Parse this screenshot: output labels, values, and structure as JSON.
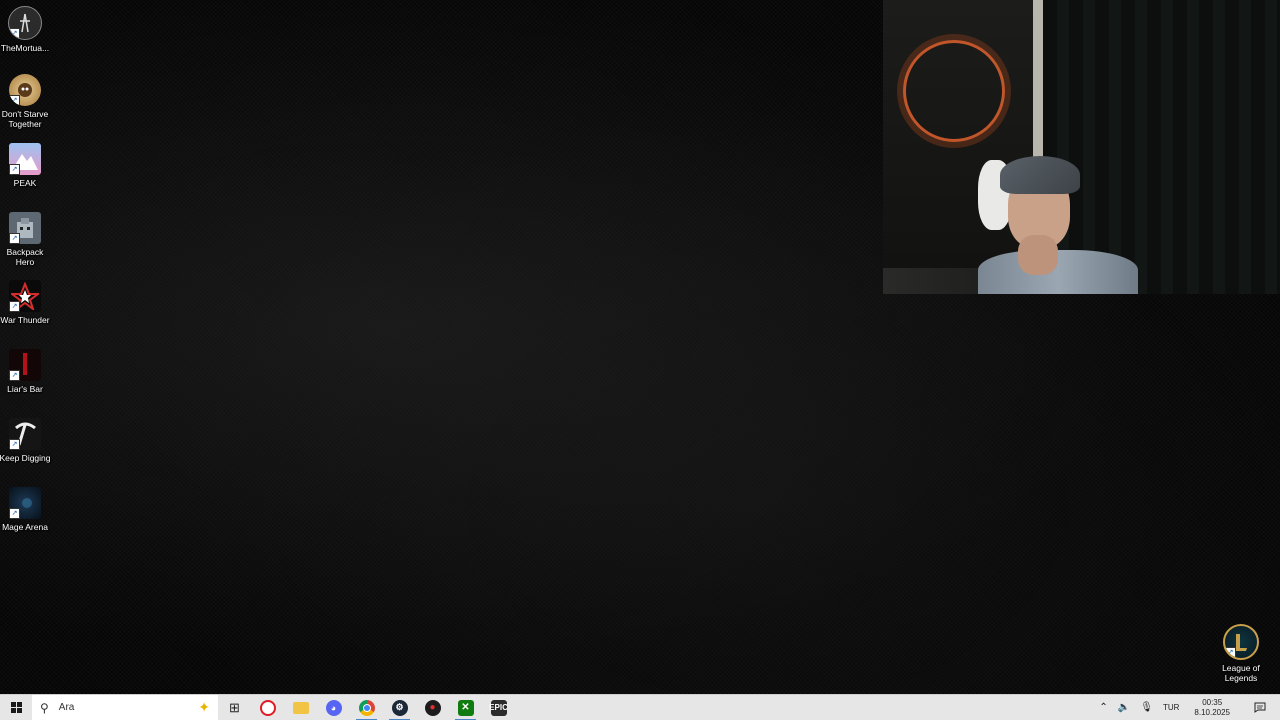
{
  "desktop": {
    "icons": [
      {
        "label": "TheMortua...",
        "icon": "mortuary-assistant-icon",
        "color": "#2b2b2b"
      },
      {
        "label": "Don't Starve\nTogether",
        "icon": "dont-starve-together-icon",
        "color": "#cfa869"
      },
      {
        "label": "PEAK",
        "icon": "peak-icon",
        "color": "#7aa6e0"
      },
      {
        "label": "Backpack\nHero",
        "icon": "backpack-hero-icon",
        "color": "#7f8a94"
      },
      {
        "label": "War Thunder",
        "icon": "war-thunder-icon",
        "color": "#b8252a"
      },
      {
        "label": "Liar's Bar",
        "icon": "liars-bar-icon",
        "color": "#1a0a0a"
      },
      {
        "label": "Keep Digging",
        "icon": "pickaxe-icon",
        "color": "#1e1e1e"
      },
      {
        "label": "Mage Arena",
        "icon": "mage-arena-icon",
        "color": "#0e1b2b"
      },
      {
        "label": "League of\nLegends",
        "icon": "league-of-legends-icon",
        "color": "#c8a04a"
      }
    ]
  },
  "webcam": {
    "content": "streamer-webcam-feed"
  },
  "taskbar": {
    "search_placeholder": "Ara",
    "apps": [
      {
        "name": "task-view",
        "icon": "task-view-icon",
        "glyph": "⊞",
        "color": "#e6e6e6",
        "text": "#222"
      },
      {
        "name": "opera",
        "icon": "opera-icon",
        "glyph": "O",
        "color": "#e01a24",
        "text": "#fff"
      },
      {
        "name": "file-explorer",
        "icon": "folder-icon",
        "glyph": "▬",
        "color": "#f0c040",
        "text": "#c28d00"
      },
      {
        "name": "discord",
        "icon": "discord-icon",
        "glyph": "◉",
        "color": "#5865f2",
        "text": "#fff"
      },
      {
        "name": "chrome",
        "icon": "chrome-icon",
        "glyph": "◎",
        "color": "#2a9d44",
        "text": "#fff"
      },
      {
        "name": "steam",
        "icon": "steam-icon",
        "glyph": "◈",
        "color": "#1b2838",
        "text": "#fff"
      },
      {
        "name": "app-red",
        "icon": "red-app-icon",
        "glyph": "●",
        "color": "#222",
        "text": "#e0302f"
      },
      {
        "name": "xbox",
        "icon": "xbox-icon",
        "glyph": "X",
        "color": "#107c10",
        "text": "#fff"
      },
      {
        "name": "epic-games",
        "icon": "epic-games-icon",
        "glyph": "E",
        "color": "#2b2b2b",
        "text": "#fff"
      }
    ],
    "tray": {
      "language": "TUR",
      "time": "00:35",
      "date": "8.10.2025"
    }
  }
}
